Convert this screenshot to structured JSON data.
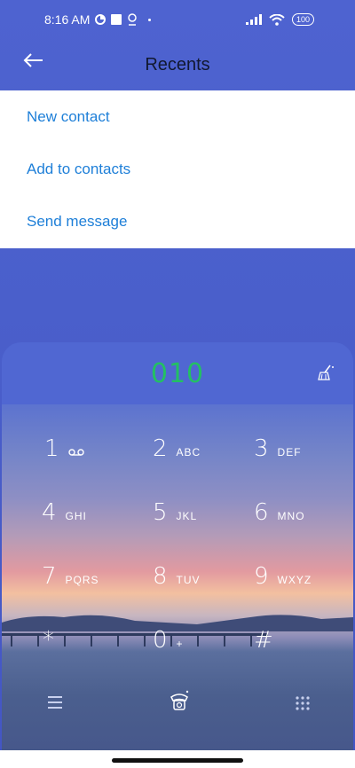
{
  "status_bar": {
    "time": "8:16 AM",
    "battery": "100"
  },
  "header": {
    "title": "Recents"
  },
  "menu": {
    "items": [
      {
        "label": "New contact"
      },
      {
        "label": "Add to contacts"
      },
      {
        "label": "Send message"
      }
    ]
  },
  "dialer": {
    "number": "010",
    "keys": [
      {
        "digit": "1",
        "letters": ""
      },
      {
        "digit": "2",
        "letters": "ABC"
      },
      {
        "digit": "3",
        "letters": "DEF"
      },
      {
        "digit": "4",
        "letters": "GHI"
      },
      {
        "digit": "5",
        "letters": "JKL"
      },
      {
        "digit": "6",
        "letters": "MNO"
      },
      {
        "digit": "7",
        "letters": "PQRS"
      },
      {
        "digit": "8",
        "letters": "TUV"
      },
      {
        "digit": "9",
        "letters": "WXYZ"
      },
      {
        "digit": "*",
        "letters": ""
      },
      {
        "digit": "0",
        "letters": "+"
      },
      {
        "digit": "#",
        "letters": ""
      }
    ]
  },
  "colors": {
    "accent": "#1e7fd8",
    "number": "#23c063",
    "header_bg": "#4e63d0"
  },
  "icons": [
    "back-arrow-icon",
    "broom-icon",
    "voicemail-icon",
    "menu-lines-icon",
    "call-icon",
    "keypad-icon"
  ]
}
